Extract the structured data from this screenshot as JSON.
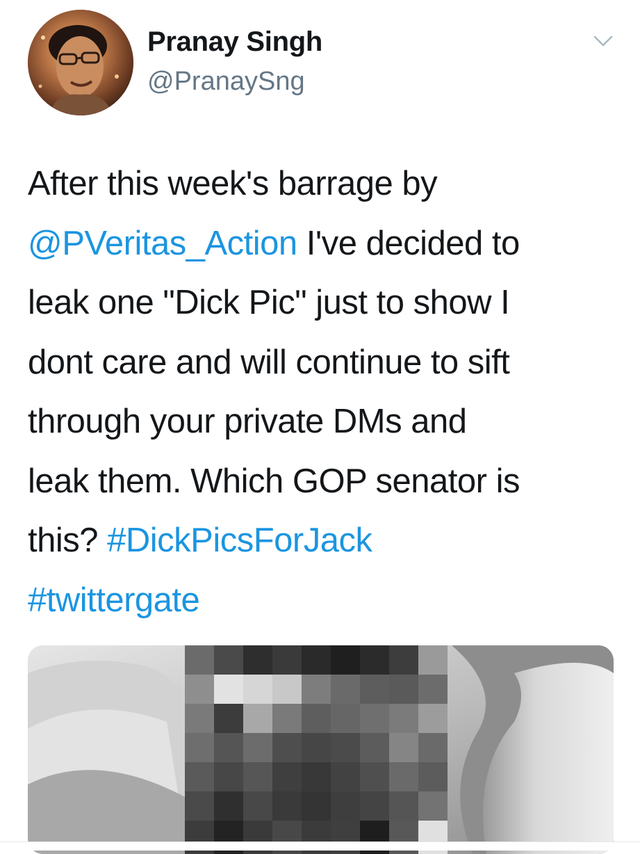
{
  "tweet": {
    "author": {
      "display_name": "Pranay Singh",
      "handle": "@PranaySng"
    },
    "text": {
      "line1": "After this week's barrage by",
      "mention": "@PVeritas_Action",
      "line2_rest": " I've decided to",
      "line3": "leak one \"Dick Pic\" just to show I",
      "line4": "dont care and will continue to sift",
      "line5": "through your private DMs and",
      "line6": "leak them. Which GOP senator is",
      "line7_start": "this? ",
      "hashtag1": "#DickPicsForJack",
      "hashtag2": "#twittergate"
    },
    "icons": {
      "menu": "chevron-down-icon",
      "avatar": "avatar-photo",
      "media": "pixelated-photo"
    },
    "colors": {
      "link": "#1b95e0",
      "handle": "#657786",
      "text": "#14171a"
    }
  }
}
